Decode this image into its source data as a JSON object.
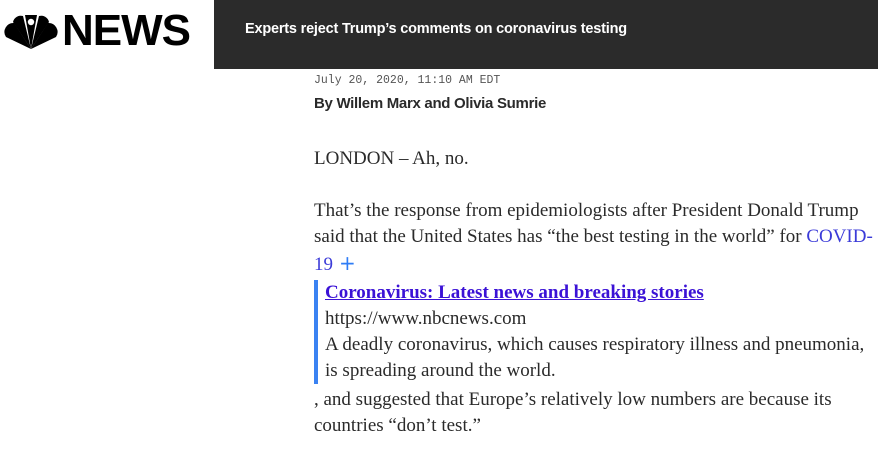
{
  "header": {
    "logo_text": "NEWS",
    "headline": "Experts reject Trump’s comments on coronavirus testing",
    "peacock_colors": [
      "#000000"
    ]
  },
  "article": {
    "dateline": "July 20, 2020, 11:10 AM EDT",
    "byline": "By Willem Marx and Olivia Sumrie",
    "para1": "LONDON – Ah, no.",
    "para2_text": "That’s the response from epidemiologists after President Donald Trump said that the United States has “the best testing in the world” for ",
    "para2_link": "COVID-19",
    "para2_plus": "+",
    "card": {
      "title": "Coronavirus: Latest news and breaking stories",
      "url": "https://www.nbcnews.com",
      "description": "A deadly coronavirus, which causes respiratory illness and pneumonia, is spreading around the world."
    },
    "para3": ", and suggested that Europe’s relatively low numbers are because its countries “don’t test.”"
  },
  "colors": {
    "headline_bar": "#2b2b2b",
    "link": "#3b3bd8",
    "card_border": "#3a82f2",
    "card_title": "#3b12d6"
  }
}
